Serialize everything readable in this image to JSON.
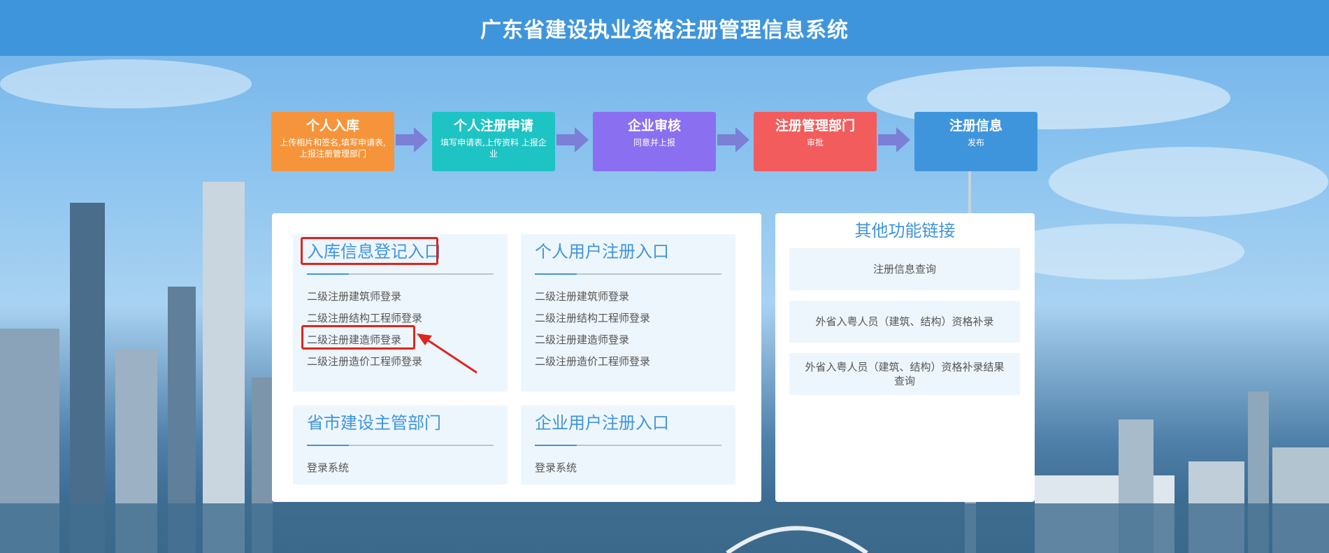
{
  "header": {
    "title": "广东省建设执业资格注册管理信息系统"
  },
  "steps": [
    {
      "title": "个人入库",
      "desc": "上传相片和签名,填写申请表,上报注册管理部门",
      "color": "#f5943a"
    },
    {
      "title": "个人注册申请",
      "desc": "填写申请表,上传资料 上报企业",
      "color": "#1ec3c4"
    },
    {
      "title": "企业审核",
      "desc": "同意并上报",
      "color": "#8a6ff0"
    },
    {
      "title": "注册管理部门",
      "desc": "审批",
      "color": "#f25c5c"
    },
    {
      "title": "注册信息",
      "desc": "发布",
      "color": "#3f95dc"
    }
  ],
  "cards": {
    "ruku": {
      "title": "入库信息登记入口",
      "links": [
        "二级注册建筑师登录",
        "二级注册结构工程师登录",
        "二级注册建造师登录",
        "二级注册造价工程师登录"
      ]
    },
    "personal": {
      "title": "个人用户注册入口",
      "links": [
        "二级注册建筑师登录",
        "二级注册结构工程师登录",
        "二级注册建造师登录",
        "二级注册造价工程师登录"
      ]
    },
    "province": {
      "title": "省市建设主管部门",
      "links": [
        "登录系统"
      ]
    },
    "enterprise": {
      "title": "企业用户注册入口",
      "links": [
        "登录系统"
      ]
    }
  },
  "other": {
    "title": "其他功能链接",
    "items": [
      "注册信息查询",
      "外省入粤人员（建筑、结构）资格补录",
      "外省入粤人员（建筑、结构）资格补录结果查询"
    ]
  },
  "colors": {
    "accent": "#3f95dc",
    "highlight": "#e0241e",
    "arrow": "#7b7fd6"
  }
}
